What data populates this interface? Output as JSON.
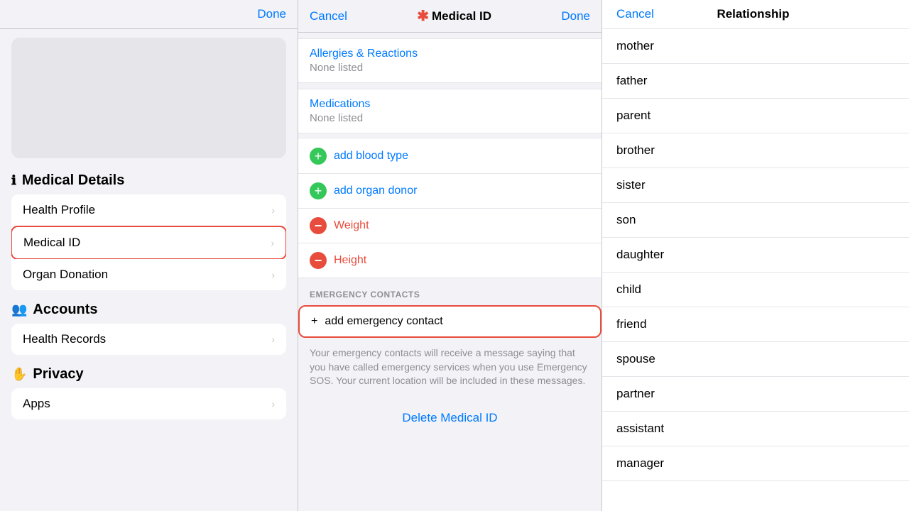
{
  "left": {
    "done_label": "Done",
    "medical_details_icon": "ℹ",
    "medical_details_label": "Medical Details",
    "menu_items": [
      {
        "id": "health-profile",
        "label": "Health Profile",
        "active": false
      },
      {
        "id": "medical-id",
        "label": "Medical ID",
        "active": true
      },
      {
        "id": "organ-donation",
        "label": "Organ Donation",
        "active": false
      }
    ],
    "accounts_icon": "👥",
    "accounts_label": "Accounts",
    "accounts_items": [
      {
        "id": "health-records",
        "label": "Health Records",
        "active": false
      }
    ],
    "privacy_icon": "✋",
    "privacy_label": "Privacy",
    "privacy_items": [
      {
        "id": "apps",
        "label": "Apps",
        "active": false
      }
    ]
  },
  "middle": {
    "cancel_label": "Cancel",
    "title": "Medical ID",
    "done_label": "Done",
    "allergies_label": "Allergies & Reactions",
    "allergies_value": "None listed",
    "medications_label": "Medications",
    "medications_value": "None listed",
    "add_blood_type_label": "add blood type",
    "add_organ_donor_label": "add organ donor",
    "weight_label": "Weight",
    "height_label": "Height",
    "emergency_contacts_label": "EMERGENCY CONTACTS",
    "add_emergency_label": "add emergency contact",
    "emergency_desc": "Your emergency contacts will receive a message saying that you have called emergency services when you use Emergency SOS. Your current location will be included in these messages.",
    "delete_label": "Delete Medical ID"
  },
  "right": {
    "cancel_label": "Cancel",
    "title": "Relationship",
    "relationships": [
      "mother",
      "father",
      "parent",
      "brother",
      "sister",
      "son",
      "daughter",
      "child",
      "friend",
      "spouse",
      "partner",
      "assistant",
      "manager"
    ]
  }
}
